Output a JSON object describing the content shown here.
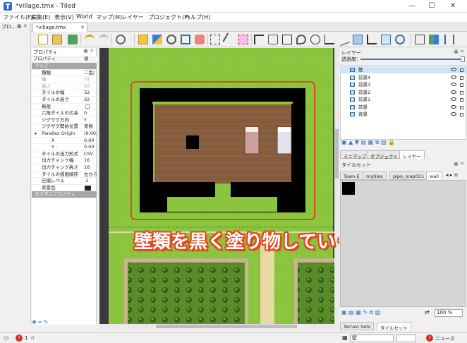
{
  "window": {
    "title": "*village.tmx - Tiled",
    "minimize_label": "—",
    "maximize_label": "☐",
    "close_label": "✕"
  },
  "menu": [
    "ファイル(F)",
    "編集(E)",
    "表示(V)",
    "World",
    "マップ(M)",
    "レイヤー",
    "プロジェクト(P)",
    "ヘルプ(H)"
  ],
  "left_panel": {
    "title": "プロ...",
    "buttons": "▣ ✕"
  },
  "document_tab": {
    "label": "*village.tmx",
    "close": "✕"
  },
  "toolbar": {
    "icons": [
      "new-icon",
      "open-icon",
      "save-icon",
      "undo-icon",
      "redo-icon",
      "command-icon",
      "stamp-brush-icon",
      "terrain-brush-icon",
      "bucket-fill-icon",
      "shape-fill-icon",
      "eraser-icon",
      "rect-select-icon",
      "magic-wand-icon",
      "select-same-tile-icon",
      "select-objects-icon",
      "edit-polygons-icon",
      "rectangle-icon",
      "point-icon",
      "ellipse-icon",
      "polygon-icon",
      "polyline-icon",
      "tile-object-icon",
      "text-icon",
      "template-icon",
      "worlds-icon",
      "random-mode-icon",
      "wang-fill-icon",
      "flip-icon"
    ]
  },
  "properties": {
    "title": "プロパティ",
    "dock_buttons": "▣ ✕",
    "header": {
      "key": "プロパティ",
      "value": "値"
    },
    "rows": [
      {
        "type": "group",
        "key": "マップ",
        "value": ""
      },
      {
        "type": "row",
        "key": "種類",
        "value": "二型/"
      },
      {
        "type": "dis",
        "key": "幅",
        "value": "32"
      },
      {
        "type": "dis",
        "key": "高さ",
        "value": "20"
      },
      {
        "type": "row",
        "key": "タイルの幅",
        "value": "32"
      },
      {
        "type": "row",
        "key": "タイルの高さ",
        "value": "32"
      },
      {
        "type": "check",
        "key": "無限",
        "value": ""
      },
      {
        "type": "row",
        "key": "六角タイルの辺長",
        "value": "0"
      },
      {
        "type": "row",
        "key": "ジグザグ方向",
        "value": "Y"
      },
      {
        "type": "row",
        "key": "ジグザグ開始位置",
        "value": "奇数"
      },
      {
        "type": "expand",
        "key": "Parallax Origin",
        "value": "(0.00,"
      },
      {
        "type": "sub",
        "key": "X",
        "value": "0.00"
      },
      {
        "type": "sub",
        "key": "Y",
        "value": "0.00"
      },
      {
        "type": "row",
        "key": "タイルの出力形式",
        "value": "CSV"
      },
      {
        "type": "row",
        "key": "出力チャンク幅",
        "value": "16"
      },
      {
        "type": "row",
        "key": "出力チャンク高さ",
        "value": "16"
      },
      {
        "type": "row",
        "key": "タイルの描画順序",
        "value": "左から"
      },
      {
        "type": "row",
        "key": "圧縮レベル",
        "value": "-1"
      },
      {
        "type": "color",
        "key": "背景色",
        "value": ""
      },
      {
        "type": "group",
        "key": "カスタムプロパティ",
        "value": ""
      }
    ],
    "bottom_buttons": "✚  ━  ✎"
  },
  "layers": {
    "title": "レイヤー",
    "opacity_label": "透過度：",
    "opacity": 1,
    "items": [
      "壁",
      "前景4",
      "前景3",
      "前景2",
      "前景1",
      "前景",
      "背景"
    ],
    "selected": "壁"
  },
  "middle_tabs": [
    "ミニマップ",
    "オブジェクト",
    "レイヤー"
  ],
  "tileset": {
    "title": "タイルセット",
    "tabs": [
      "Town-E",
      "mytiles",
      "pipo_map001",
      "wall"
    ],
    "active_tab": "wall",
    "zoom": "100 %"
  },
  "bottom_tabs": [
    "Terrain Sets",
    "タイルセット"
  ],
  "statusbar": {
    "error_count": "1",
    "warning_count": "0",
    "layer_combo": "壁",
    "news_label": "ニュース"
  },
  "annotation": "壁類を黒く塗り物していく",
  "colors": {
    "grass": "#8cc63f",
    "grass_dark": "#7bb436",
    "wall": "#000000",
    "floor": "#8a6040",
    "highlight_box": "#e04a1f",
    "path": "#e7d8a4"
  }
}
